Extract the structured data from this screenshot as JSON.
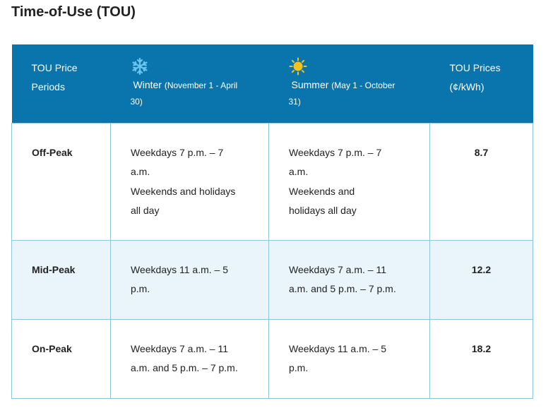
{
  "page": {
    "title": "Time-of-Use (TOU)"
  },
  "table": {
    "header": {
      "periods_line1": "TOU Price",
      "periods_line2": "Periods",
      "winter_name": "Winter",
      "winter_dates_line1": "(November 1 - April",
      "winter_dates_line2": "30)",
      "winter_icon": "snowflake-icon",
      "summer_name": "Summer",
      "summer_dates_line1": "(May 1 - October",
      "summer_dates_line2": "31)",
      "summer_icon": "sun-icon",
      "prices_line1": "TOU Prices",
      "prices_line2": "(¢/kWh)"
    },
    "rows": [
      {
        "period": "Off-Peak",
        "winter": [
          "Weekdays 7 p.m. – 7",
          "a.m.",
          "Weekends and holidays",
          "all day"
        ],
        "summer": [
          "Weekdays 7 p.m. – 7",
          "a.m.",
          "Weekends and",
          "holidays all day"
        ],
        "price": "8.7"
      },
      {
        "period": "Mid-Peak",
        "winter": [
          "Weekdays 11 a.m. – 5",
          "p.m."
        ],
        "summer": [
          "Weekdays 7 a.m. – 11",
          "a.m. and 5 p.m. – 7 p.m."
        ],
        "price": "12.2"
      },
      {
        "period": "On-Peak",
        "winter": [
          "Weekdays 7 a.m. – 11",
          "a.m. and 5 p.m. – 7 p.m."
        ],
        "summer": [
          "Weekdays 11 a.m. – 5",
          "p.m."
        ],
        "price": "18.2"
      }
    ]
  },
  "colors": {
    "header_bg": "#0a75ad",
    "header_text": "#ffffff",
    "row_alt_bg": "#eaf4fb",
    "border": "#8ec5de",
    "snowflake": "#6cc4f0",
    "sun": "#f7c21b"
  }
}
